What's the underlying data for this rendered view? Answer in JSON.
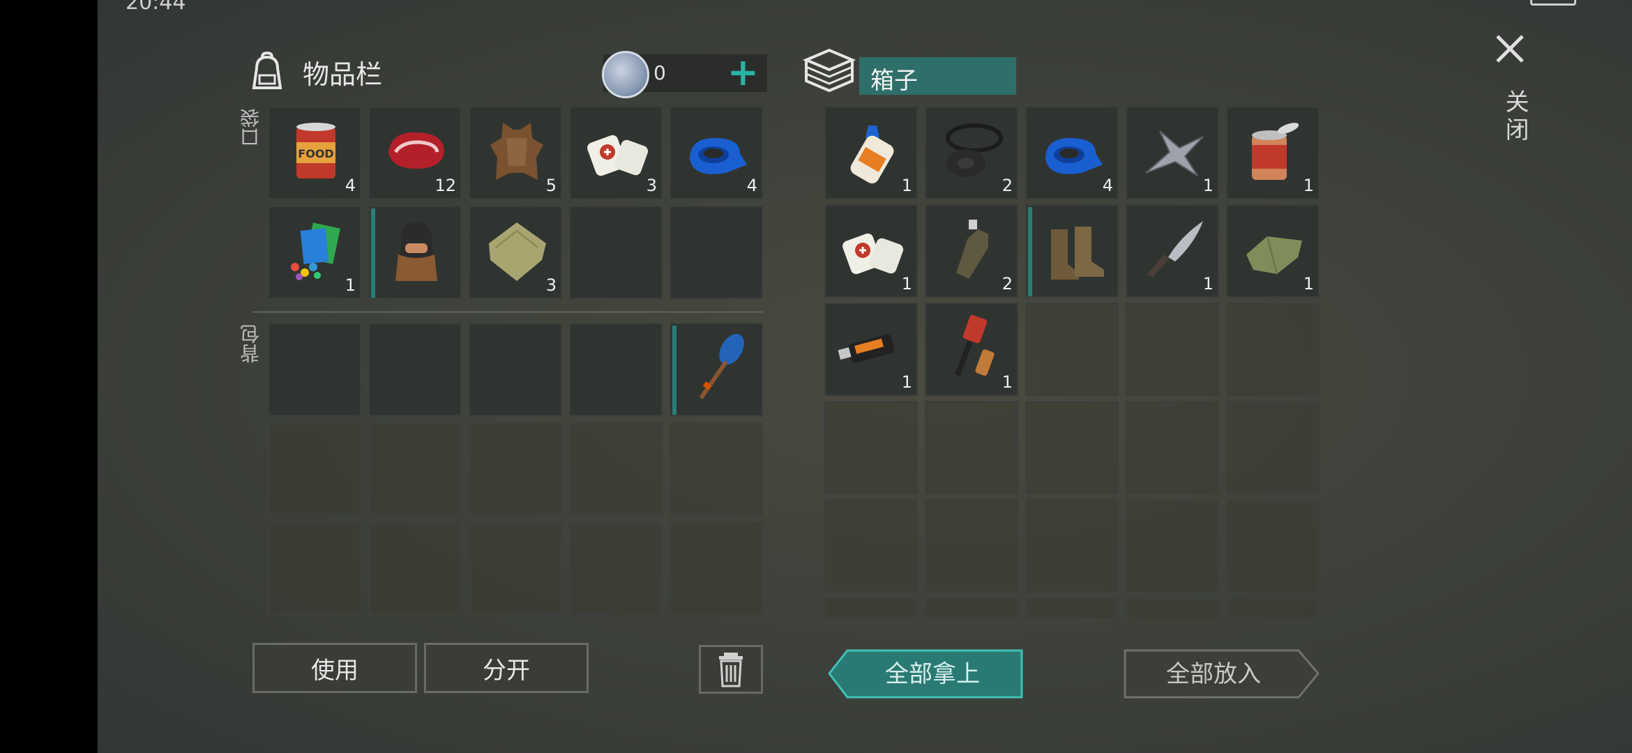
{
  "status": {
    "time": "20:44"
  },
  "inventory": {
    "title": "物品栏",
    "coins": "0",
    "pocket_label": "口袋",
    "backpack_label": "背包",
    "pocket_slots": [
      {
        "icon": "food-can-icon",
        "count": "4"
      },
      {
        "icon": "raw-meat-icon",
        "count": "12"
      },
      {
        "icon": "animal-hide-icon",
        "count": "5"
      },
      {
        "icon": "bandage-icon",
        "count": "3"
      },
      {
        "icon": "blue-tape-icon",
        "count": "4"
      },
      {
        "icon": "seed-packets-icon",
        "count": "1"
      },
      {
        "icon": "balaclava-icon",
        "count": "",
        "bar": true
      },
      {
        "icon": "cloth-scrap-icon",
        "count": "3"
      },
      {
        "icon": "",
        "count": ""
      },
      {
        "icon": "",
        "count": ""
      }
    ],
    "backpack_slots": [
      {
        "icon": "",
        "count": ""
      },
      {
        "icon": "",
        "count": ""
      },
      {
        "icon": "",
        "count": ""
      },
      {
        "icon": "",
        "count": ""
      },
      {
        "icon": "paddle-icon",
        "count": "",
        "bar": true
      }
    ]
  },
  "box": {
    "title": "箱子",
    "slots": [
      {
        "icon": "glue-icon",
        "count": "1"
      },
      {
        "icon": "rubber-rings-icon",
        "count": "2"
      },
      {
        "icon": "blue-tape-icon",
        "count": "4"
      },
      {
        "icon": "metal-scrap-icon",
        "count": "1"
      },
      {
        "icon": "open-can-icon",
        "count": "1"
      },
      {
        "icon": "bandage-icon",
        "count": "1"
      },
      {
        "icon": "bottle-icon",
        "count": "2"
      },
      {
        "icon": "boots-icon",
        "count": "",
        "bar": true
      },
      {
        "icon": "knife-icon",
        "count": "1"
      },
      {
        "icon": "green-cloth-icon",
        "count": "1"
      },
      {
        "icon": "usb-drive-icon",
        "count": "1"
      },
      {
        "icon": "flare-icon",
        "count": "1"
      }
    ]
  },
  "buttons": {
    "use": "使用",
    "split": "分开",
    "take_all": "全部拿上",
    "put_all": "全部放入",
    "close": "关闭"
  },
  "colors": {
    "accent": "#2bb3a8",
    "bar": "#2a7c78",
    "take_all_bg": "#2a7a74"
  }
}
